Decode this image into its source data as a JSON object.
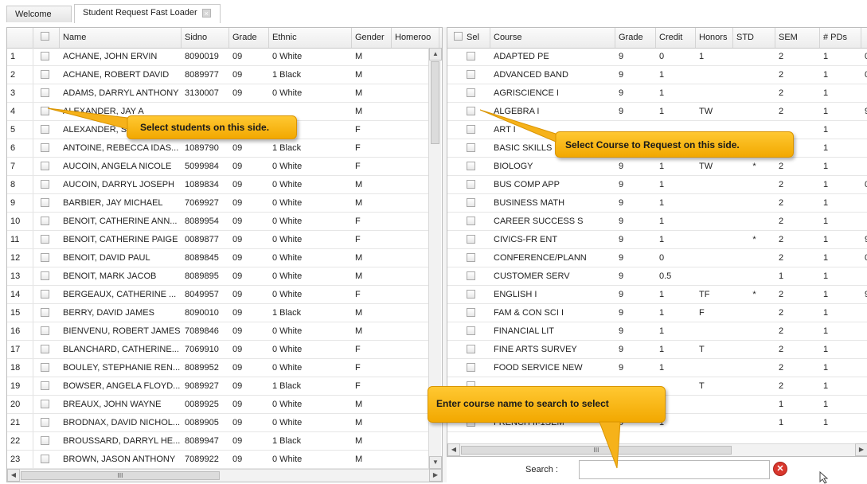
{
  "tabs": [
    {
      "label": "Welcome"
    },
    {
      "label": "Student Request Fast Loader",
      "close_glyph": "×"
    }
  ],
  "students": {
    "columns": {
      "name": "Name",
      "sidno": "Sidno",
      "grade": "Grade",
      "ethnic": "Ethnic",
      "gender": "Gender",
      "homeroom": "Homeroo"
    },
    "rows": [
      {
        "num": "1",
        "name": "ACHANE, JOHN ERVIN",
        "sidno": "8090019",
        "grade": "09",
        "ethnic": "0 White",
        "gender": "M"
      },
      {
        "num": "2",
        "name": "ACHANE, ROBERT DAVID",
        "sidno": "8089977",
        "grade": "09",
        "ethnic": "1 Black",
        "gender": "M"
      },
      {
        "num": "3",
        "name": "ADAMS, DARRYL ANTHONY",
        "sidno": "3130007",
        "grade": "09",
        "ethnic": "0 White",
        "gender": "M"
      },
      {
        "num": "4",
        "name": "ALEXANDER, JAY A",
        "sidno": "",
        "grade": "",
        "ethnic": "",
        "gender": "M"
      },
      {
        "num": "5",
        "name": "ALEXANDER, SHE",
        "sidno": "",
        "grade": "",
        "ethnic": "",
        "gender": "F"
      },
      {
        "num": "6",
        "name": "ANTOINE, REBECCA IDAS...",
        "sidno": "1089790",
        "grade": "09",
        "ethnic": "1 Black",
        "gender": "F"
      },
      {
        "num": "7",
        "name": "AUCOIN, ANGELA NICOLE",
        "sidno": "5099984",
        "grade": "09",
        "ethnic": "0 White",
        "gender": "F"
      },
      {
        "num": "8",
        "name": "AUCOIN, DARRYL JOSEPH",
        "sidno": "1089834",
        "grade": "09",
        "ethnic": "0 White",
        "gender": "M"
      },
      {
        "num": "9",
        "name": "BARBIER, JAY MICHAEL",
        "sidno": "7069927",
        "grade": "09",
        "ethnic": "0 White",
        "gender": "M"
      },
      {
        "num": "10",
        "name": "BENOIT, CATHERINE ANN...",
        "sidno": "8089954",
        "grade": "09",
        "ethnic": "0 White",
        "gender": "F"
      },
      {
        "num": "11",
        "name": "BENOIT, CATHERINE PAIGE",
        "sidno": "0089877",
        "grade": "09",
        "ethnic": "0 White",
        "gender": "F"
      },
      {
        "num": "12",
        "name": "BENOIT, DAVID PAUL",
        "sidno": "8089845",
        "grade": "09",
        "ethnic": "0 White",
        "gender": "M"
      },
      {
        "num": "13",
        "name": "BENOIT, MARK JACOB",
        "sidno": "8089895",
        "grade": "09",
        "ethnic": "0 White",
        "gender": "M"
      },
      {
        "num": "14",
        "name": "BERGEAUX, CATHERINE ...",
        "sidno": "8049957",
        "grade": "09",
        "ethnic": "0 White",
        "gender": "F"
      },
      {
        "num": "15",
        "name": "BERRY, DAVID JAMES",
        "sidno": "8090010",
        "grade": "09",
        "ethnic": "1 Black",
        "gender": "M"
      },
      {
        "num": "16",
        "name": "BIENVENU, ROBERT JAMES",
        "sidno": "7089846",
        "grade": "09",
        "ethnic": "0 White",
        "gender": "M"
      },
      {
        "num": "17",
        "name": "BLANCHARD, CATHERINE...",
        "sidno": "7069910",
        "grade": "09",
        "ethnic": "0 White",
        "gender": "F"
      },
      {
        "num": "18",
        "name": "BOULEY, STEPHANIE REN...",
        "sidno": "8089952",
        "grade": "09",
        "ethnic": "0 White",
        "gender": "F"
      },
      {
        "num": "19",
        "name": "BOWSER, ANGELA FLOYD...",
        "sidno": "9089927",
        "grade": "09",
        "ethnic": "1 Black",
        "gender": "F"
      },
      {
        "num": "20",
        "name": "BREAUX, JOHN WAYNE",
        "sidno": "0089925",
        "grade": "09",
        "ethnic": "0 White",
        "gender": "M"
      },
      {
        "num": "21",
        "name": "BRODNAX, DAVID NICHOL...",
        "sidno": "0089905",
        "grade": "09",
        "ethnic": "0 White",
        "gender": "M"
      },
      {
        "num": "22",
        "name": "BROUSSARD, DARRYL HE...",
        "sidno": "8089947",
        "grade": "09",
        "ethnic": "1 Black",
        "gender": "M"
      },
      {
        "num": "23",
        "name": "BROWN, JASON ANTHONY",
        "sidno": "7089922",
        "grade": "09",
        "ethnic": "0 White",
        "gender": "M"
      }
    ],
    "hscroll_glyph": "III"
  },
  "courses": {
    "columns": {
      "sel": "Sel",
      "course": "Course",
      "grade": "Grade",
      "credit": "Credit",
      "honors": "Honors",
      "std": "STD",
      "sem": "SEM",
      "pds": "# PDs"
    },
    "rows": [
      {
        "course": "ADAPTED PE",
        "grade": "9",
        "credit": "0",
        "honors": "1",
        "std": "",
        "sem": "2",
        "pds": "1",
        "extra": "0"
      },
      {
        "course": "ADVANCED BAND",
        "grade": "9",
        "credit": "1",
        "honors": "",
        "std": "",
        "sem": "2",
        "pds": "1",
        "extra": "0"
      },
      {
        "course": "AGRISCIENCE I",
        "grade": "9",
        "credit": "1",
        "honors": "",
        "std": "",
        "sem": "2",
        "pds": "1",
        "extra": ""
      },
      {
        "course": "ALGEBRA I",
        "grade": "9",
        "credit": "1",
        "honors": "TW",
        "std": "",
        "sem": "2",
        "pds": "1",
        "extra": "9"
      },
      {
        "course": "ART I",
        "grade": "",
        "credit": "",
        "honors": "",
        "std": "",
        "sem": "",
        "pds": "1",
        "extra": ""
      },
      {
        "course": "BASIC SKILLS",
        "grade": "",
        "credit": "",
        "honors": "",
        "std": "",
        "sem": "",
        "pds": "1",
        "extra": ""
      },
      {
        "course": "BIOLOGY",
        "grade": "9",
        "credit": "1",
        "honors": "TW",
        "std": "*",
        "sem": "2",
        "pds": "1",
        "extra": ""
      },
      {
        "course": "BUS COMP APP",
        "grade": "9",
        "credit": "1",
        "honors": "",
        "std": "",
        "sem": "2",
        "pds": "1",
        "extra": "0"
      },
      {
        "course": "BUSINESS MATH",
        "grade": "9",
        "credit": "1",
        "honors": "",
        "std": "",
        "sem": "2",
        "pds": "1",
        "extra": ""
      },
      {
        "course": "CAREER SUCCESS S",
        "grade": "9",
        "credit": "1",
        "honors": "",
        "std": "",
        "sem": "2",
        "pds": "1",
        "extra": ""
      },
      {
        "course": "CIVICS-FR ENT",
        "grade": "9",
        "credit": "1",
        "honors": "",
        "std": "*",
        "sem": "2",
        "pds": "1",
        "extra": "9"
      },
      {
        "course": "CONFERENCE/PLANN",
        "grade": "9",
        "credit": "0",
        "honors": "",
        "std": "",
        "sem": "2",
        "pds": "1",
        "extra": "0"
      },
      {
        "course": "CUSTOMER SERV",
        "grade": "9",
        "credit": "0.5",
        "honors": "",
        "std": "",
        "sem": "1",
        "pds": "1",
        "extra": ""
      },
      {
        "course": "ENGLISH I",
        "grade": "9",
        "credit": "1",
        "honors": "TF",
        "std": "*",
        "sem": "2",
        "pds": "1",
        "extra": "9"
      },
      {
        "course": "FAM & CON SCI I",
        "grade": "9",
        "credit": "1",
        "honors": "F",
        "std": "",
        "sem": "2",
        "pds": "1",
        "extra": ""
      },
      {
        "course": "FINANCIAL LIT",
        "grade": "9",
        "credit": "1",
        "honors": "",
        "std": "",
        "sem": "2",
        "pds": "1",
        "extra": ""
      },
      {
        "course": "FINE ARTS SURVEY",
        "grade": "9",
        "credit": "1",
        "honors": "T",
        "std": "",
        "sem": "2",
        "pds": "1",
        "extra": ""
      },
      {
        "course": "FOOD SERVICE NEW",
        "grade": "9",
        "credit": "1",
        "honors": "",
        "std": "",
        "sem": "2",
        "pds": "1",
        "extra": ""
      },
      {
        "course": "",
        "grade": "",
        "credit": "",
        "honors": "T",
        "std": "",
        "sem": "2",
        "pds": "1",
        "extra": ""
      },
      {
        "course": "",
        "grade": "",
        "credit": "",
        "honors": "",
        "std": "",
        "sem": "1",
        "pds": "1",
        "extra": ""
      },
      {
        "course": "FRENCH II-1SEM",
        "grade": "9",
        "credit": "1",
        "honors": "",
        "std": "",
        "sem": "1",
        "pds": "1",
        "extra": ""
      }
    ],
    "hscroll_glyph": "III"
  },
  "search": {
    "label": "Search :",
    "value": "",
    "clear_glyph": "✕"
  },
  "callouts": {
    "students": "Select students on this side.",
    "courses": "Select Course to Request on this side.",
    "search": "Enter course name to search to select"
  },
  "colors": {
    "callout": "#f5b10d",
    "clear": "#d9372d"
  }
}
